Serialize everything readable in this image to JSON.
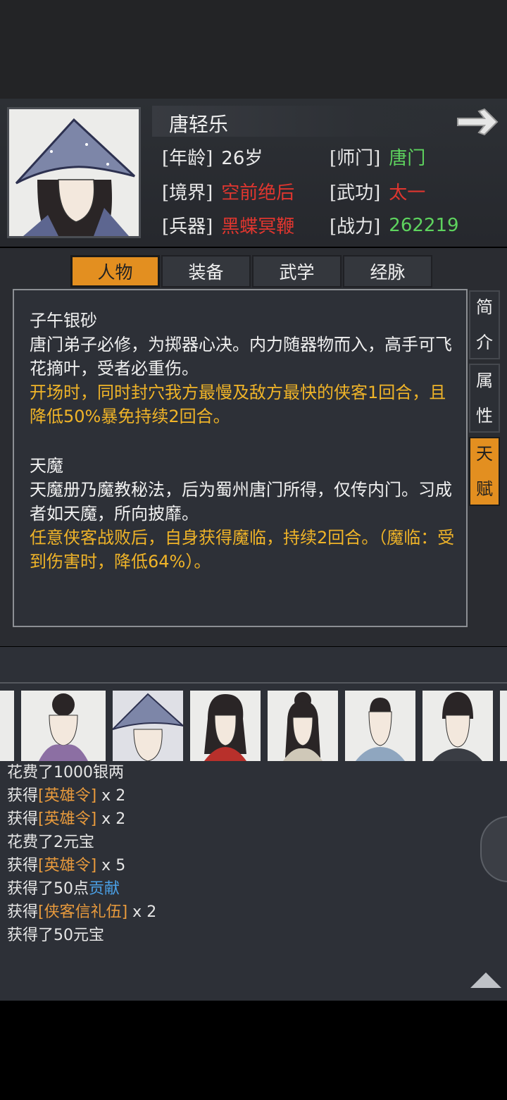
{
  "character": {
    "name": "唐轻乐",
    "fields": [
      {
        "label": "[年龄]",
        "value": "26岁",
        "color": "white"
      },
      {
        "label": "[师门]",
        "value": "唐门",
        "color": "green"
      },
      {
        "label": "[境界]",
        "value": "空前绝后",
        "color": "red"
      },
      {
        "label": "[武功]",
        "value": "太一",
        "color": "red"
      },
      {
        "label": "[兵器]",
        "value": "黑蝶冥鞭",
        "color": "red"
      },
      {
        "label": "[战力]",
        "value": "262219",
        "color": "green"
      }
    ]
  },
  "tabs": [
    "人物",
    "装备",
    "武学",
    "经脉"
  ],
  "active_tab": "人物",
  "side_tabs": [
    {
      "line1": "简",
      "line2": "介"
    },
    {
      "line1": "属",
      "line2": "性"
    },
    {
      "line1": "天",
      "line2": "赋"
    }
  ],
  "talents": [
    {
      "title": "子午银砂",
      "desc": "唐门弟子必修，为掷器心决。内力随器物而入，高手可飞花摘叶，受者必重伤。",
      "effect": "开场时，同时封穴我方最慢及敌方最快的侠客1回合，且降低50%暴免持续2回合。"
    },
    {
      "title": "天魔",
      "desc": "天魔册乃魔教秘法，后为蜀州唐门所得，仅传内门。习成者如天魔，所向披靡。",
      "effect": "任意侠客战败后，自身获得魔临，持续2回合。（魔临：受到伤害时，降低64%）。"
    }
  ],
  "log": [
    {
      "pre": "花费了1000银两",
      "item": "",
      "post": "",
      "item_color": ""
    },
    {
      "pre": "获得",
      "item": "[英雄令]",
      "post": " x 2",
      "item_color": "orange"
    },
    {
      "pre": "获得",
      "item": "[英雄令]",
      "post": " x 2",
      "item_color": "orange"
    },
    {
      "pre": "花费了2元宝",
      "item": "",
      "post": "",
      "item_color": ""
    },
    {
      "pre": "获得",
      "item": "[英雄令]",
      "post": " x 5",
      "item_color": "orange"
    },
    {
      "pre": "获得了50点",
      "item": "贡献",
      "post": "",
      "item_color": "blue"
    },
    {
      "pre": "获得",
      "item": "[侠客信礼伍]",
      "post": " x 2",
      "item_color": "orange"
    },
    {
      "pre": "获得了50元宝",
      "item": "",
      "post": "",
      "item_color": ""
    }
  ],
  "colors": {
    "accent": "#e38f20",
    "effect_text": "#f0b428",
    "value_red": "#e0362f",
    "value_green": "#5ed35e"
  }
}
